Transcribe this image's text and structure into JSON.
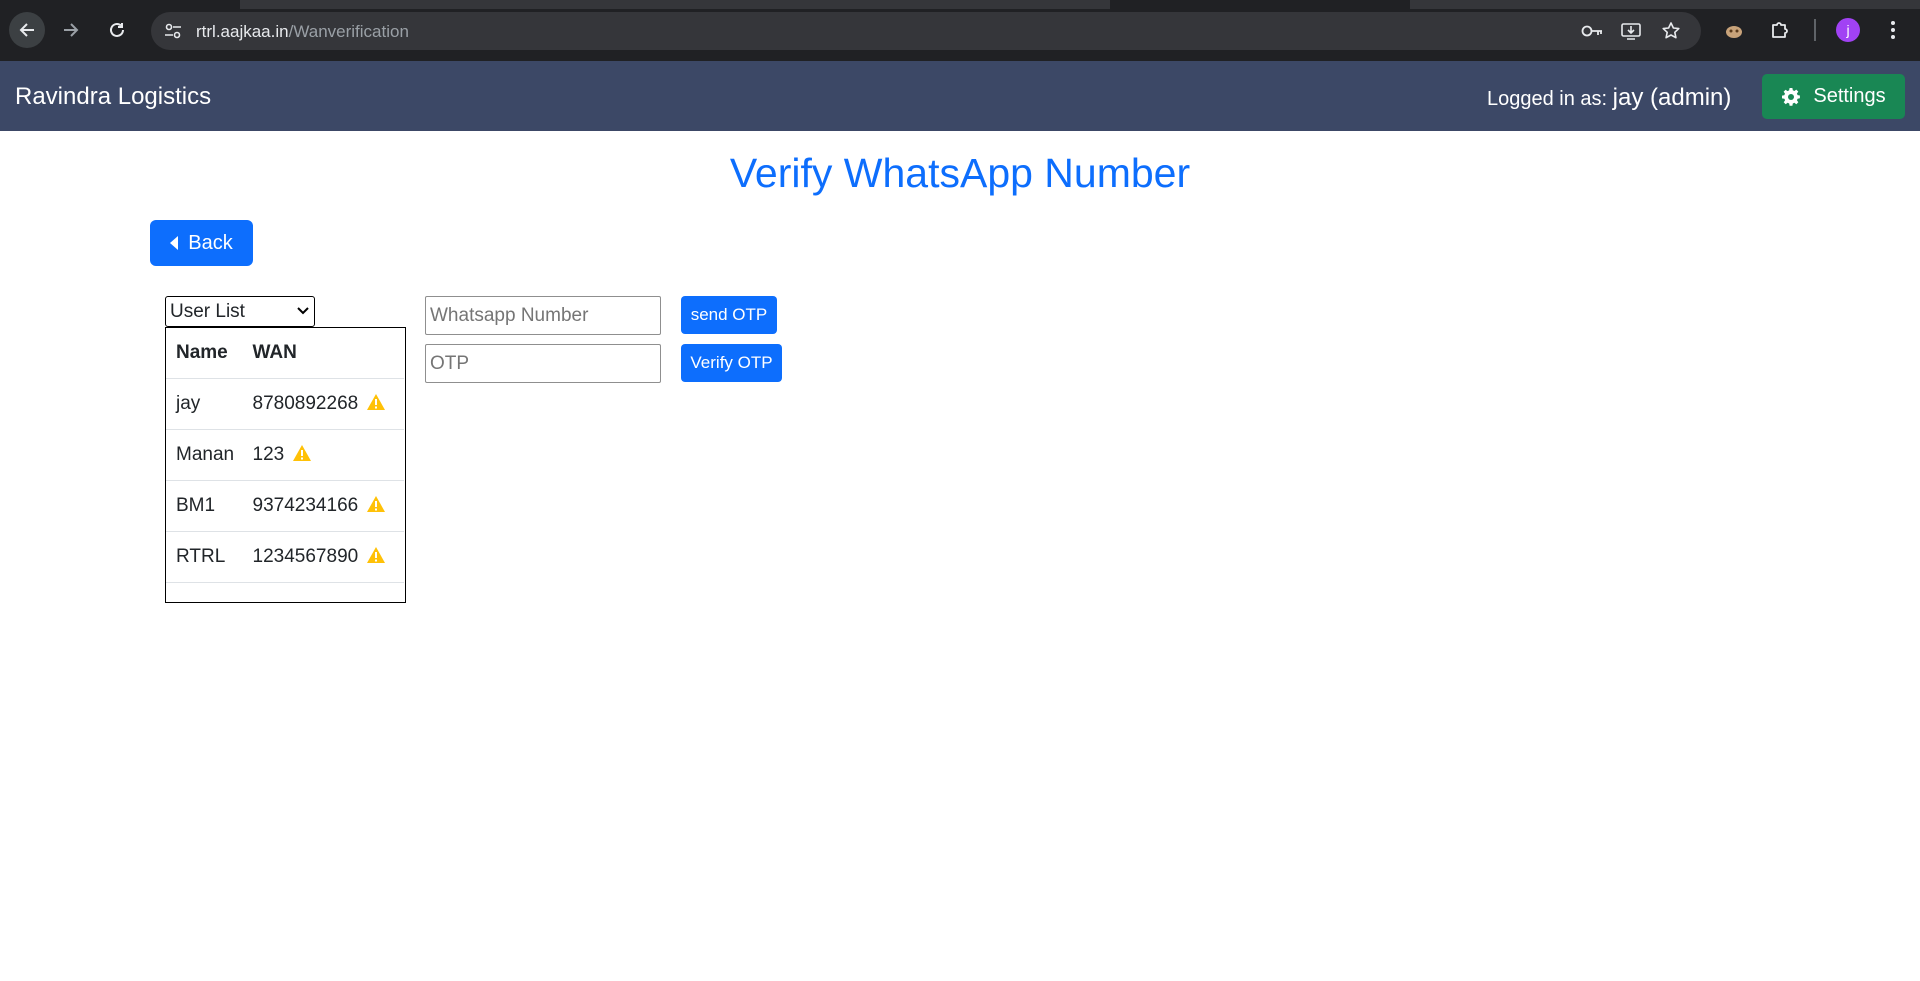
{
  "browser": {
    "url_host": "rtrl.aajkaa.in",
    "url_path": "/Wanverification",
    "avatar_letter": "j",
    "icons": [
      "back-icon",
      "forward-icon",
      "reload-icon",
      "site-info-icon",
      "password-key-icon",
      "install-app-icon",
      "bookmark-star-icon",
      "extension-puzzle-icon",
      "profile-extension-icon",
      "kebab-menu-icon"
    ]
  },
  "navbar": {
    "brand": "Ravindra Logistics",
    "logged_in_prefix": "Logged in as:",
    "logged_in_user": "jay (admin)",
    "settings_label": "Settings",
    "bg_color": "#3c4866",
    "settings_color": "#198754"
  },
  "main": {
    "title": "Verify WhatsApp Number",
    "back_label": "Back",
    "user_select_value": "User List",
    "table": {
      "headers": [
        "Name",
        "WAN"
      ],
      "rows": [
        {
          "name": "jay",
          "wan": "8780892268",
          "status": "warning"
        },
        {
          "name": "Manan",
          "wan": "123",
          "status": "warning"
        },
        {
          "name": "BM1",
          "wan": "9374234166",
          "status": "warning"
        },
        {
          "name": "RTRL",
          "wan": "1234567890",
          "status": "warning"
        }
      ]
    },
    "whatsapp_placeholder": "Whatsapp Number",
    "otp_placeholder": "OTP",
    "send_otp_label": "send OTP",
    "verify_otp_label": "Verify OTP",
    "accent_color": "#0d6efd",
    "warning_color": "#ffc107"
  }
}
